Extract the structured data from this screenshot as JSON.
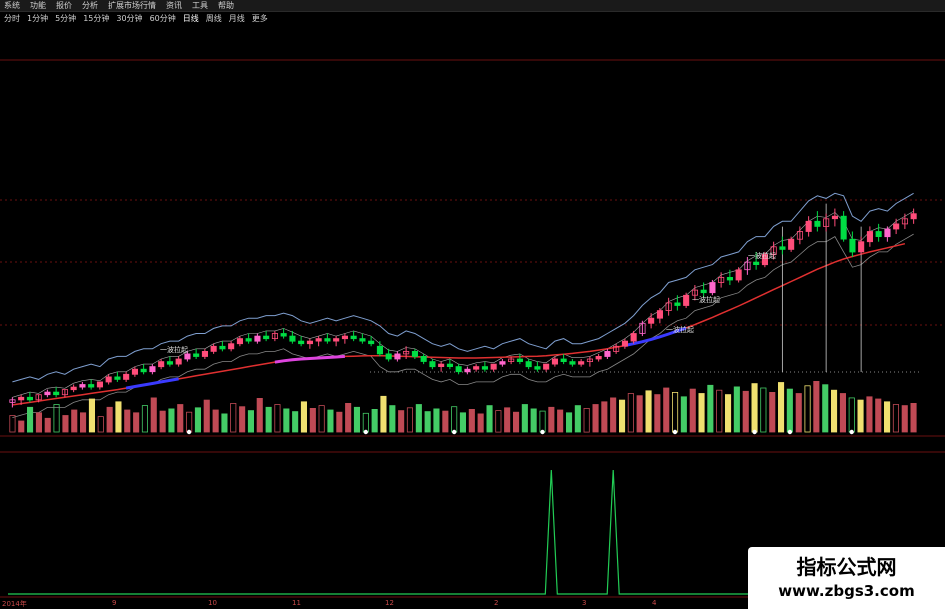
{
  "colors": {
    "up": "#ff4d7a",
    "down": "#00dd44",
    "up_hollow": "#ff66cc",
    "ma_long": "#e03030",
    "ma_accent_blue": "#3a3aff",
    "ma_accent_magenta": "#dd44dd",
    "band": "#7f9fd0",
    "vol_yellow": "#f0e070",
    "vol_red": "#c04a55",
    "vol_green": "#44cc66",
    "indicator_spike": "#22cc55",
    "grid": "#6a1010"
  },
  "menubar": [
    {
      "label": "系统"
    },
    {
      "label": "功能"
    },
    {
      "label": "报价"
    },
    {
      "label": "分析"
    },
    {
      "label": "扩展市场行情"
    },
    {
      "label": "资讯"
    },
    {
      "label": "工具"
    },
    {
      "label": "帮助"
    }
  ],
  "periods": [
    {
      "label": "分时"
    },
    {
      "label": "1分钟"
    },
    {
      "label": "5分钟"
    },
    {
      "label": "15分钟"
    },
    {
      "label": "30分钟"
    },
    {
      "label": "60分钟"
    },
    {
      "label": "日线",
      "active": true
    },
    {
      "label": "周线"
    },
    {
      "label": "月线"
    },
    {
      "label": "更多"
    }
  ],
  "info_line_1": "",
  "info_line_2": "",
  "legend": [
    {
      "text": "",
      "color": "#e0d040",
      "top": 46
    },
    {
      "text": "",
      "color": "#e0e0e0",
      "top": 72
    },
    {
      "text": "",
      "color": "#dd55dd",
      "top": 96
    },
    {
      "text": "",
      "color": "#dd55dd",
      "top": 120
    },
    {
      "text": "",
      "color": "#ff5555",
      "top": 145
    },
    {
      "text": "",
      "color": "#e0e0e0",
      "top": 168
    },
    {
      "text": "",
      "color": "#e0e0e0",
      "top": 187
    }
  ],
  "chart_annotations": [
    {
      "text": "",
      "color": "#e0c050",
      "x": 168,
      "y": 50
    },
    {
      "text": "",
      "color": "#7a7aff",
      "x": 185,
      "y": 78
    },
    {
      "text": "一波拉起",
      "color": "#e0e0e0",
      "x": 160,
      "y": 352
    },
    {
      "text": "一波拉起",
      "color": "#e0e0e0",
      "x": 692,
      "y": 302
    },
    {
      "text": "一波拉起",
      "color": "#e0e0e0",
      "x": 666,
      "y": 332
    },
    {
      "text": "一波拉起",
      "color": "#e0e0e0",
      "x": 748,
      "y": 258
    }
  ],
  "right_labels": [
    {
      "text": "",
      "top": 24
    },
    {
      "text": "",
      "top": 167
    }
  ],
  "indicator_label": "",
  "indicator_title": "",
  "axis_labels": [
    "2014年",
    "9",
    "10",
    "11",
    "12",
    "2",
    "3",
    "4"
  ],
  "watermark": {
    "line1": "指标公式网",
    "line2": "www.zbgs3.com"
  },
  "chart_data": [
    {
      "type": "candlestick",
      "title": "",
      "xlabel": "",
      "ylabel": "",
      "note": "K线价格值按面板相对刻度读取(0-100),原图价格轴刻度不可辨识",
      "ylim": [
        0,
        100
      ],
      "x_axis_ticks": [
        "2014年",
        "9",
        "10",
        "11",
        "12",
        "2",
        "3",
        "4"
      ],
      "candles_ohlc": [
        [
          3,
          5,
          1,
          4
        ],
        [
          4,
          6,
          2,
          5
        ],
        [
          5,
          7,
          3,
          4
        ],
        [
          4,
          6,
          3,
          6
        ],
        [
          6,
          8,
          5,
          7
        ],
        [
          7,
          9,
          5,
          6
        ],
        [
          6,
          8,
          5,
          8
        ],
        [
          8,
          10,
          7,
          9
        ],
        [
          9,
          11,
          8,
          10
        ],
        [
          10,
          12,
          8,
          9
        ],
        [
          9,
          11,
          8,
          11
        ],
        [
          11,
          14,
          10,
          13
        ],
        [
          13,
          15,
          11,
          12
        ],
        [
          12,
          15,
          11,
          14
        ],
        [
          14,
          17,
          13,
          16
        ],
        [
          16,
          18,
          14,
          15
        ],
        [
          15,
          18,
          14,
          17
        ],
        [
          17,
          20,
          16,
          19
        ],
        [
          19,
          21,
          17,
          18
        ],
        [
          18,
          21,
          17,
          20
        ],
        [
          20,
          23,
          19,
          22
        ],
        [
          22,
          24,
          20,
          21
        ],
        [
          21,
          24,
          20,
          23
        ],
        [
          23,
          26,
          22,
          25
        ],
        [
          25,
          27,
          23,
          24
        ],
        [
          24,
          27,
          23,
          26
        ],
        [
          26,
          29,
          25,
          28
        ],
        [
          28,
          30,
          26,
          27
        ],
        [
          27,
          30,
          26,
          29
        ],
        [
          29,
          31,
          27,
          28
        ],
        [
          28,
          31,
          27,
          30
        ],
        [
          30,
          32,
          28,
          29
        ],
        [
          29,
          31,
          26,
          27
        ],
        [
          27,
          29,
          25,
          26
        ],
        [
          26,
          28,
          24,
          27
        ],
        [
          27,
          29,
          25,
          28
        ],
        [
          28,
          30,
          26,
          27
        ],
        [
          27,
          29,
          25,
          28
        ],
        [
          28,
          30,
          26,
          29
        ],
        [
          29,
          31,
          27,
          28
        ],
        [
          28,
          30,
          26,
          27
        ],
        [
          27,
          29,
          25,
          26
        ],
        [
          25,
          27,
          21,
          22
        ],
        [
          22,
          24,
          19,
          20
        ],
        [
          20,
          23,
          19,
          22
        ],
        [
          22,
          25,
          20,
          23
        ],
        [
          23,
          24,
          20,
          21
        ],
        [
          21,
          22,
          18,
          19
        ],
        [
          19,
          20,
          16,
          17
        ],
        [
          17,
          19,
          15,
          18
        ],
        [
          18,
          20,
          16,
          17
        ],
        [
          17,
          18,
          14,
          15
        ],
        [
          15,
          17,
          14,
          16
        ],
        [
          16,
          18,
          15,
          17
        ],
        [
          17,
          19,
          15,
          16
        ],
        [
          16,
          18,
          15,
          18
        ],
        [
          18,
          20,
          17,
          19
        ],
        [
          19,
          21,
          18,
          20
        ],
        [
          20,
          22,
          18,
          19
        ],
        [
          19,
          20,
          16,
          17
        ],
        [
          17,
          19,
          15,
          16
        ],
        [
          16,
          18,
          15,
          18
        ],
        [
          18,
          21,
          17,
          20
        ],
        [
          20,
          22,
          18,
          19
        ],
        [
          19,
          20,
          17,
          18
        ],
        [
          18,
          20,
          17,
          19
        ],
        [
          19,
          21,
          17,
          20
        ],
        [
          20,
          22,
          19,
          21
        ],
        [
          21,
          24,
          20,
          23
        ],
        [
          23,
          26,
          22,
          25
        ],
        [
          25,
          28,
          24,
          27
        ],
        [
          27,
          31,
          26,
          30
        ],
        [
          30,
          35,
          29,
          34
        ],
        [
          34,
          38,
          32,
          36
        ],
        [
          36,
          40,
          34,
          39
        ],
        [
          39,
          44,
          37,
          42
        ],
        [
          42,
          45,
          39,
          41
        ],
        [
          41,
          46,
          40,
          45
        ],
        [
          45,
          49,
          43,
          47
        ],
        [
          47,
          50,
          44,
          46
        ],
        [
          46,
          51,
          45,
          50
        ],
        [
          50,
          54,
          48,
          52
        ],
        [
          52,
          55,
          49,
          51
        ],
        [
          51,
          56,
          50,
          55
        ],
        [
          55,
          60,
          53,
          58
        ],
        [
          58,
          62,
          55,
          57
        ],
        [
          57,
          62,
          56,
          61
        ],
        [
          61,
          66,
          59,
          64
        ],
        [
          64,
          68,
          61,
          63
        ],
        [
          63,
          68,
          62,
          67
        ],
        [
          67,
          72,
          65,
          70
        ],
        [
          70,
          76,
          68,
          74
        ],
        [
          74,
          78,
          70,
          72
        ],
        [
          72,
          77,
          70,
          75
        ],
        [
          75,
          79,
          72,
          76
        ],
        [
          76,
          78,
          66,
          67
        ],
        [
          67,
          70,
          60,
          62
        ],
        [
          62,
          68,
          61,
          66
        ],
        [
          66,
          72,
          64,
          70
        ],
        [
          70,
          73,
          66,
          68
        ],
        [
          68,
          72,
          66,
          71
        ],
        [
          71,
          75,
          69,
          73
        ],
        [
          73,
          77,
          71,
          75
        ],
        [
          75,
          79,
          73,
          77
        ]
      ],
      "ma_long": [
        2,
        2.5,
        3,
        3.5,
        4,
        4.5,
        5,
        5.5,
        6,
        6.5,
        7,
        7.5,
        8,
        8.6,
        9.2,
        9.8,
        10.4,
        11,
        11.6,
        12.2,
        12.8,
        13.4,
        14,
        14.6,
        15.2,
        15.8,
        16.4,
        17,
        17.6,
        18.2,
        18.8,
        19.3,
        19.7,
        20,
        20.2,
        20.4,
        20.6,
        20.8,
        21,
        21.1,
        21.2,
        21.3,
        21.3,
        21.2,
        21.1,
        21,
        20.9,
        20.8,
        20.7,
        20.6,
        20.5,
        20.4,
        20.4,
        20.4,
        20.5,
        20.6,
        20.7,
        20.8,
        20.9,
        21,
        21.1,
        21.3,
        21.6,
        21.9,
        22.2,
        22.6,
        23,
        23.5,
        24,
        24.6,
        25.3,
        26,
        26.8,
        27.7,
        28.7,
        29.8,
        31,
        32.2,
        33.5,
        34.9,
        36.3,
        37.8,
        39.3,
        40.8,
        42.4,
        44,
        45.6,
        47.2,
        48.8,
        50.4,
        52,
        53.6,
        55.2,
        56.6,
        58,
        59.2,
        60.2,
        61.1,
        62,
        62.8,
        63.6,
        64.4,
        65.2
      ]
    },
    {
      "type": "bar",
      "title": "",
      "note": "成交量柱,相对值0-100",
      "ylim": [
        0,
        100
      ],
      "values": [
        30,
        20,
        45,
        35,
        25,
        50,
        30,
        40,
        35,
        60,
        28,
        45,
        55,
        40,
        35,
        48,
        62,
        38,
        42,
        50,
        36,
        44,
        58,
        40,
        33,
        52,
        46,
        39,
        61,
        45,
        50,
        42,
        37,
        55,
        43,
        48,
        40,
        36,
        52,
        45,
        34,
        41,
        65,
        48,
        39,
        44,
        50,
        37,
        42,
        38,
        46,
        35,
        41,
        33,
        48,
        39,
        44,
        36,
        50,
        42,
        38,
        45,
        40,
        35,
        48,
        43,
        50,
        55,
        62,
        58,
        70,
        66,
        75,
        68,
        80,
        72,
        64,
        78,
        70,
        85,
        76,
        68,
        82,
        74,
        88,
        80,
        72,
        90,
        78,
        70,
        84,
        92,
        86,
        76,
        70,
        62,
        58,
        64,
        60,
        55,
        50,
        48,
        52
      ],
      "colors_by_bar": "yellow=放量, red=涨, green=跌"
    },
    {
      "type": "line",
      "title": "",
      "note": "指标仅在两处出现尖峰,其余为0",
      "ylim": [
        0,
        1
      ],
      "values_spike_positions": [
        61,
        68
      ],
      "spike_height": 1
    }
  ]
}
